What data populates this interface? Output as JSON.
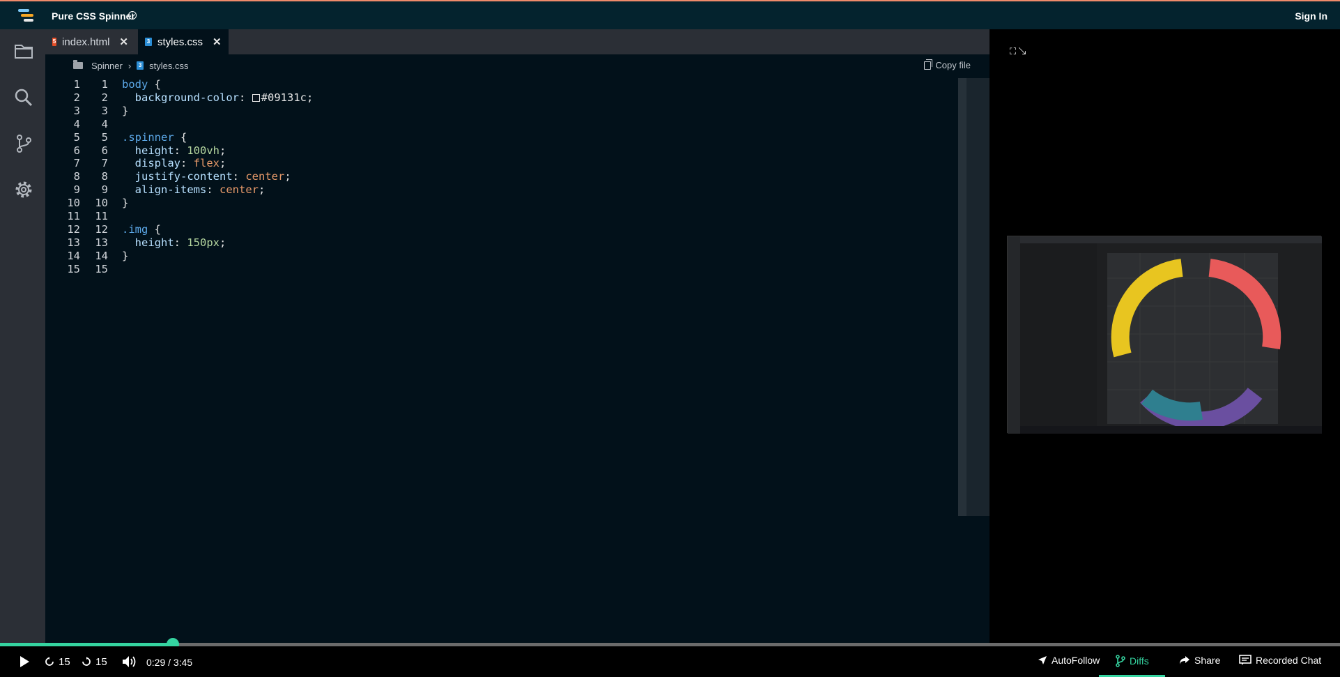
{
  "app": {
    "title": "Pure CSS Spinner",
    "signin_label": "Sign In"
  },
  "tabs": [
    {
      "label": "index.html",
      "icon": "html-file-icon",
      "active": false
    },
    {
      "label": "styles.css",
      "icon": "css-file-icon",
      "active": true
    }
  ],
  "breadcrumb": {
    "folder": "Spinner",
    "separator": "›",
    "file": "styles.css"
  },
  "copy_file_label": "Copy file",
  "code": {
    "lines": [
      {
        "n": "1",
        "text": "body {"
      },
      {
        "n": "2",
        "text": "  background-color: #09131c;"
      },
      {
        "n": "3",
        "text": "}"
      },
      {
        "n": "4",
        "text": ""
      },
      {
        "n": "5",
        "text": ".spinner {"
      },
      {
        "n": "6",
        "text": "  height: 100vh;"
      },
      {
        "n": "7",
        "text": "  display: flex;"
      },
      {
        "n": "8",
        "text": "  justify-content: center;"
      },
      {
        "n": "9",
        "text": "  align-items: center;"
      },
      {
        "n": "10",
        "text": "}"
      },
      {
        "n": "11",
        "text": ""
      },
      {
        "n": "12",
        "text": ".img {"
      },
      {
        "n": "13",
        "text": "  height: 150px;"
      },
      {
        "n": "14",
        "text": "}"
      },
      {
        "n": "15",
        "text": ""
      }
    ],
    "swatch_color": "#09131c"
  },
  "player": {
    "back_label": "15",
    "forward_label": "15",
    "time": "0:29 / 3:45",
    "progress": 0.129,
    "autofollow_label": "AutoFollow",
    "diffs_label": "Diffs",
    "share_label": "Share",
    "chat_label": "Recorded Chat"
  },
  "colors": {
    "accent": "#35d4a0",
    "topbar": "#04232e",
    "editor_bg": "#02111a"
  }
}
